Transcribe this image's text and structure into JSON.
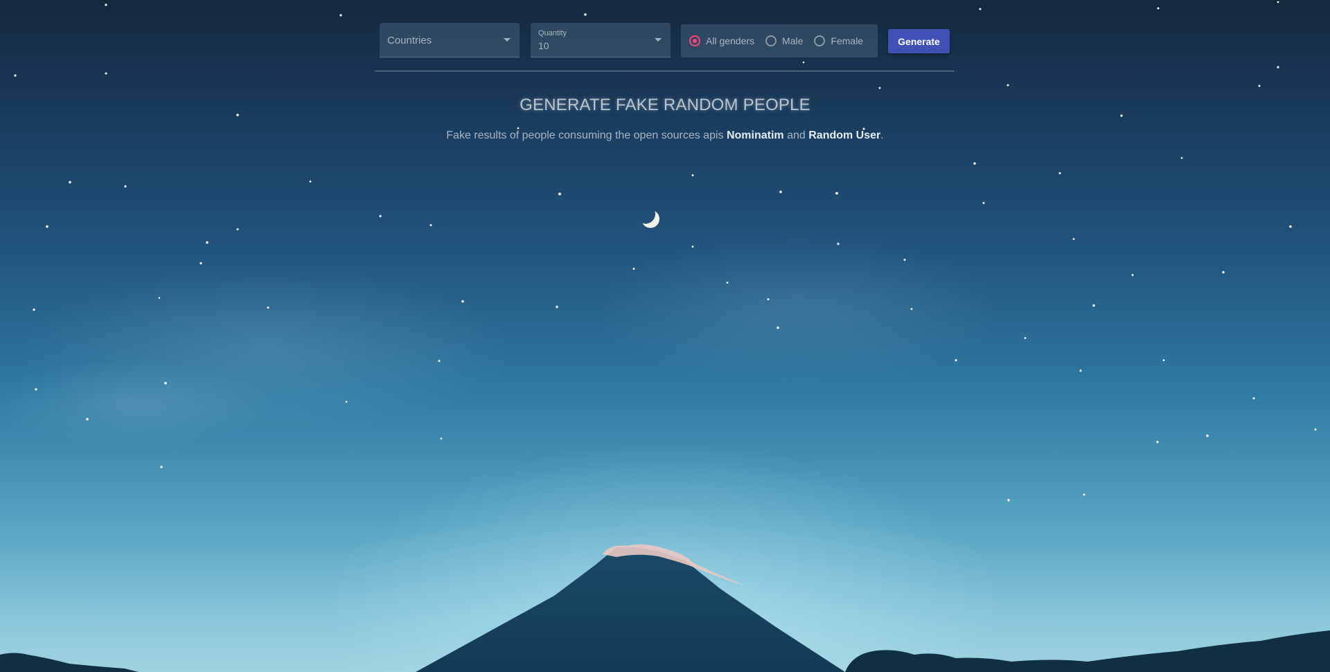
{
  "filters": {
    "countries": {
      "placeholder": "Countries"
    },
    "quantity": {
      "label": "Quantity",
      "value": "10"
    },
    "gender": {
      "options": [
        {
          "label": "All genders",
          "checked": true
        },
        {
          "label": "Male",
          "checked": false
        },
        {
          "label": "Female",
          "checked": false
        }
      ]
    },
    "generate_label": "Generate"
  },
  "header": {
    "title": "GENERATE FAKE RANDOM PEOPLE",
    "subtitle_prefix": "Fake results of people consuming the open sources apis ",
    "api_1": "Nominatim",
    "subtitle_and": " and ",
    "api_2": "Random User",
    "subtitle_suffix": "."
  },
  "colors": {
    "accent_button": "#3f51b5",
    "radio_checked": "#ff4081"
  },
  "icons": {
    "dropdown": "chevron-down-icon",
    "moon": "crescent-moon-icon"
  }
}
